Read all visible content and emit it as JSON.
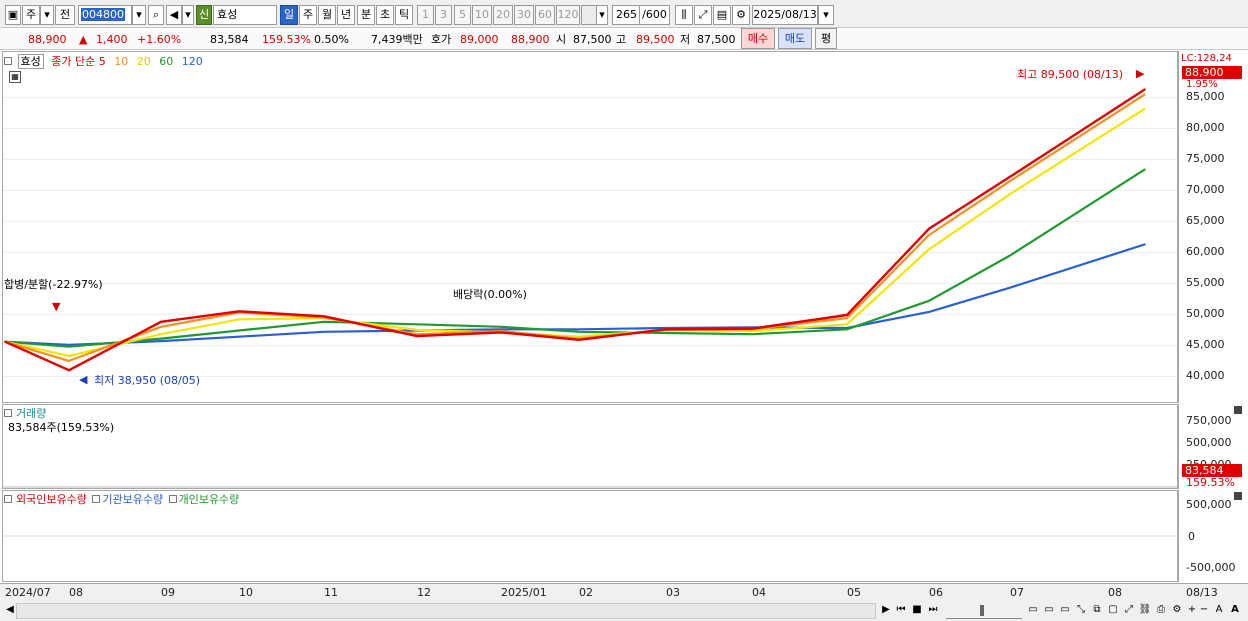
{
  "toolbar": {
    "period": "주",
    "prev": "전",
    "code": "004800",
    "badge": "신",
    "name": "효성",
    "units": [
      "일",
      "주",
      "월",
      "년",
      "분",
      "초",
      "틱"
    ],
    "intervals": [
      "1",
      "3",
      "5",
      "10",
      "20",
      "30",
      "60",
      "120"
    ],
    "count": "265",
    "total": "/600",
    "date": "2025/08/13"
  },
  "quote": {
    "price": "88,900",
    "arrow": "▲",
    "change": "1,400",
    "change_pct": "+1.60%",
    "volume": "83,584",
    "volume_ratio": "159.53%",
    "turnover": "0.50%",
    "amount": "7,439백만",
    "ask_label": "호가",
    "ask": "89,000",
    "bid": "88,900",
    "open_label": "시",
    "open": "87,500",
    "high_label": "고",
    "high": "89,500",
    "low_label": "저",
    "low": "87,500",
    "buy": "매수",
    "sell": "매도",
    "eval": "평"
  },
  "price_panel": {
    "stock_tab": "효성",
    "legend_title": "종가 단순",
    "ma_periods": [
      "5",
      "10",
      "20",
      "60",
      "120"
    ],
    "lc_label": "LC:128,24",
    "last_price_tag": "88,900",
    "last_pct": "1.95%",
    "axis_labels": [
      "85,000",
      "80,000",
      "75,000",
      "70,000",
      "65,000",
      "60,000",
      "55,000",
      "50,000",
      "45,000",
      "40,000"
    ],
    "annot_high": "최고 89,500 (08/13)",
    "annot_low": "최저 38,950 (08/05)",
    "annot_merge": "합병/분할(-22.97%)",
    "annot_dividend": "배당락(0.00%)"
  },
  "volume_panel": {
    "title": "거래량",
    "value_line": "83,584주(159.53%)",
    "axis_labels": [
      "750,000",
      "500,000",
      "250,000"
    ],
    "tag": "83,584",
    "tag_pct": "159.53%"
  },
  "holdings_panel": {
    "legend": [
      "외국인보유수량",
      "기관보유수량",
      "개인보유수량"
    ],
    "axis_labels": [
      "500,000",
      "0",
      "-500,000"
    ]
  },
  "date_axis": {
    "labels": [
      "2024/07",
      "08",
      "09",
      "10",
      "11",
      "12",
      "2025/01",
      "02",
      "03",
      "04",
      "05",
      "06",
      "07",
      "08"
    ],
    "end_date": "08/13"
  },
  "colors": {
    "up": "#d40000",
    "down": "#1d3fc0",
    "ma5": "#e00000",
    "ma10": "#f5901e",
    "ma20": "#f2e600",
    "ma60": "#1f9a2f",
    "ma120": "#2a5fd6"
  },
  "chart_data": {
    "type": "line",
    "title": "",
    "ylim": [
      37000,
      90000
    ],
    "x": [
      "2024/07",
      "08",
      "09",
      "10",
      "11",
      "12",
      "2025/01",
      "02",
      "03",
      "04",
      "05",
      "06",
      "07",
      "08"
    ],
    "series": [
      {
        "name": "5",
        "values": [
          45600,
          41000,
          48800,
          50500,
          49700,
          46500,
          47100,
          45900,
          47600,
          47700,
          49900,
          63800,
          72200,
          86300
        ]
      },
      {
        "name": "10",
        "values": [
          45600,
          42500,
          48000,
          50300,
          49500,
          46800,
          47300,
          46100,
          47500,
          47600,
          49400,
          62800,
          71500,
          85500
        ]
      },
      {
        "name": "20",
        "values": [
          45600,
          43300,
          46800,
          49200,
          49400,
          47500,
          47100,
          46400,
          47500,
          47300,
          48400,
          60500,
          69400,
          83200
        ]
      },
      {
        "name": "60",
        "values": [
          45600,
          44800,
          46100,
          47400,
          48800,
          48400,
          48000,
          47200,
          47000,
          46800,
          47600,
          52200,
          59500,
          73400
        ]
      },
      {
        "name": "120",
        "values": [
          45600,
          45100,
          45700,
          46400,
          47200,
          47400,
          47600,
          47600,
          47800,
          47900,
          47800,
          50400,
          54300,
          61300
        ]
      }
    ]
  }
}
